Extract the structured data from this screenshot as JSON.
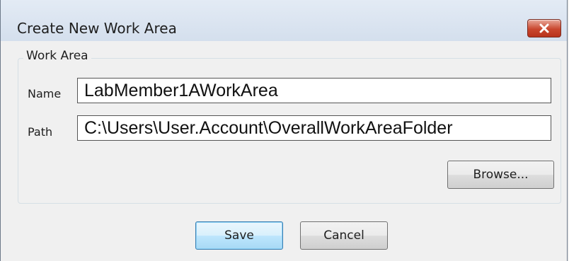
{
  "window": {
    "title": "Create New Work Area"
  },
  "group": {
    "label": "Work Area",
    "name_label": "Name",
    "name_value": "LabMember1AWorkArea",
    "path_label": "Path",
    "path_value": "C:\\Users\\User.Account\\OverallWorkAreaFolder",
    "browse_label": "Browse..."
  },
  "actions": {
    "save_label": "Save",
    "cancel_label": "Cancel"
  },
  "colors": {
    "close_button": "#c9472e",
    "default_button_border": "#3c7fb1",
    "titlebar": "#dae4f0"
  }
}
